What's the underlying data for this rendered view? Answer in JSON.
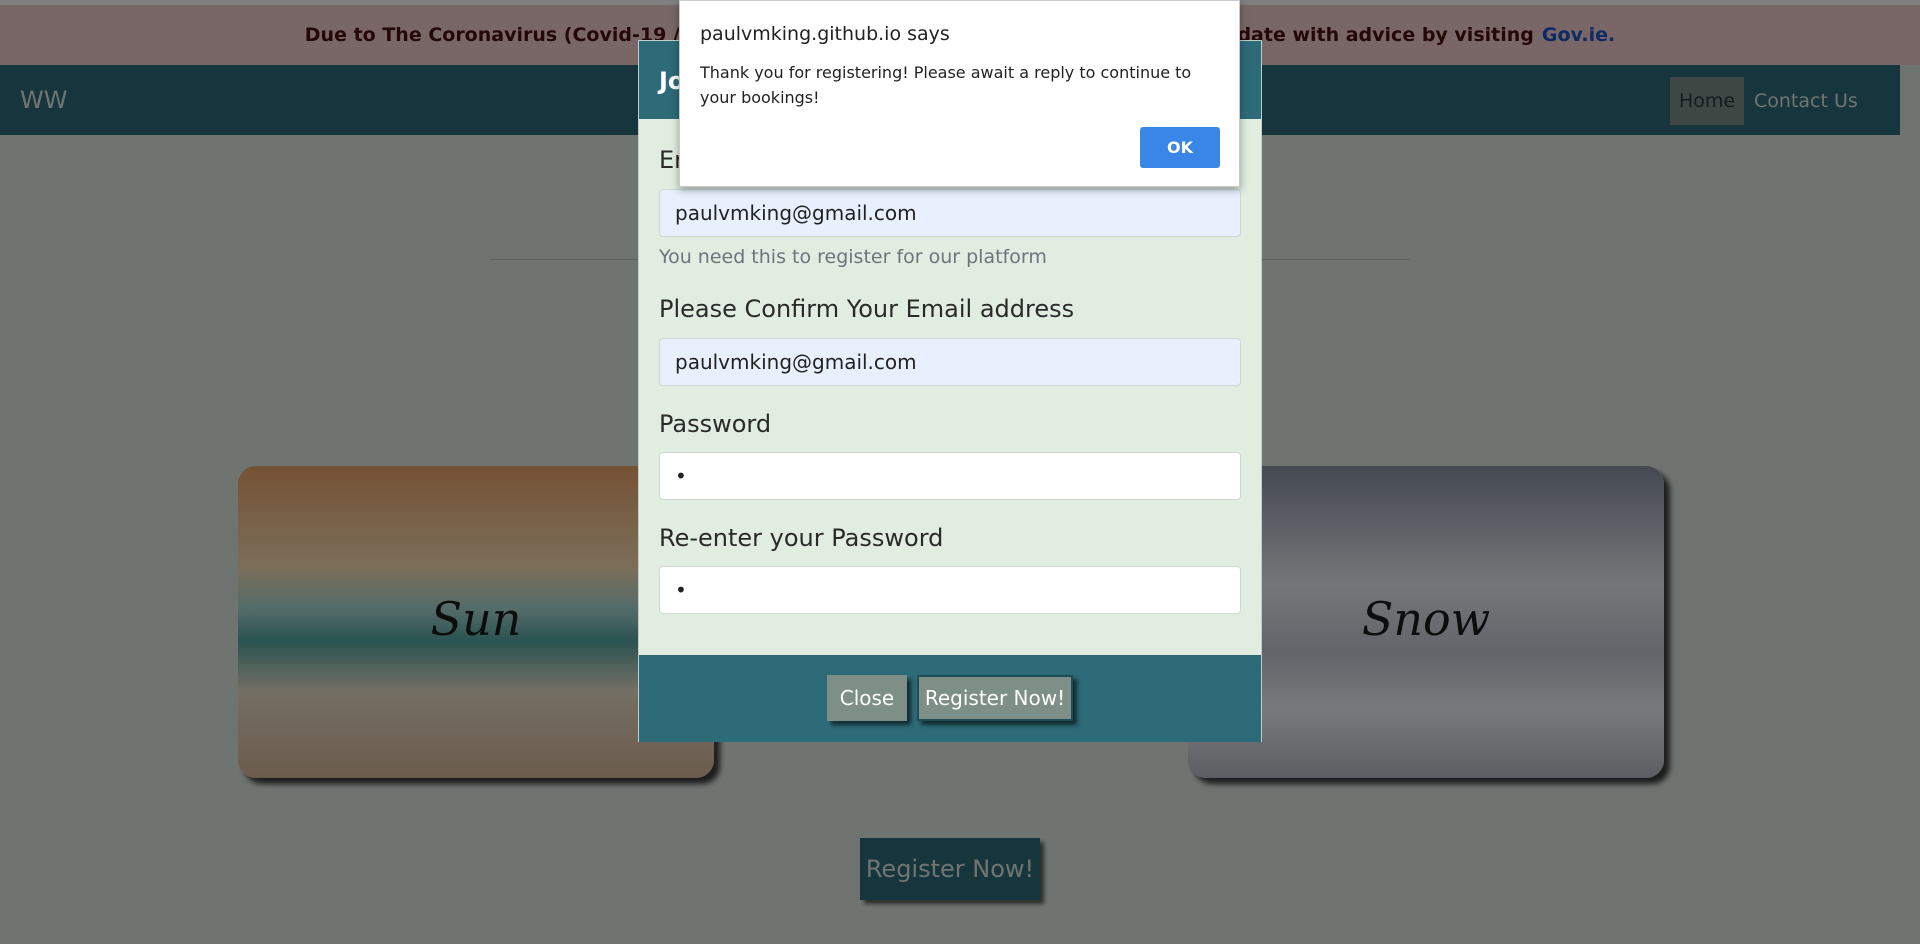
{
  "banner": {
    "text": "Due to The Coronavirus (Covid-19 / C-19) Pa",
    "text_after": "p up to date with advice by visiting",
    "link": "Gov.ie."
  },
  "navbar": {
    "brand": "WW",
    "home": "Home",
    "contact": "Contact Us"
  },
  "cards": [
    {
      "label": "Sun"
    },
    {
      "label": "Snow"
    }
  ],
  "main": {
    "register_button": "Register Now!"
  },
  "modal": {
    "title": "Jo",
    "email_label": "Er",
    "email_value": "paulvmking@gmail.com",
    "email_help": "You need this to register for our platform",
    "confirm_label": "Please Confirm Your Email address",
    "confirm_value": "paulvmking@gmail.com",
    "password_label": "Password",
    "password_value": "•",
    "reenter_label": "Re-enter your Password",
    "reenter_value": "•",
    "close_button": "Close",
    "register_button": "Register Now!"
  },
  "alert": {
    "title": "paulvmking.github.io says",
    "message": "Thank you for registering!  Please await a reply to continue to your bookings!",
    "ok_button": "OK"
  },
  "colors": {
    "navbar": "#2d6b78",
    "banner": "#f2cfcf",
    "page_bg": "#dfe9e3",
    "button_grey": "#7d8f86",
    "alert_ok": "#3a86e6"
  }
}
